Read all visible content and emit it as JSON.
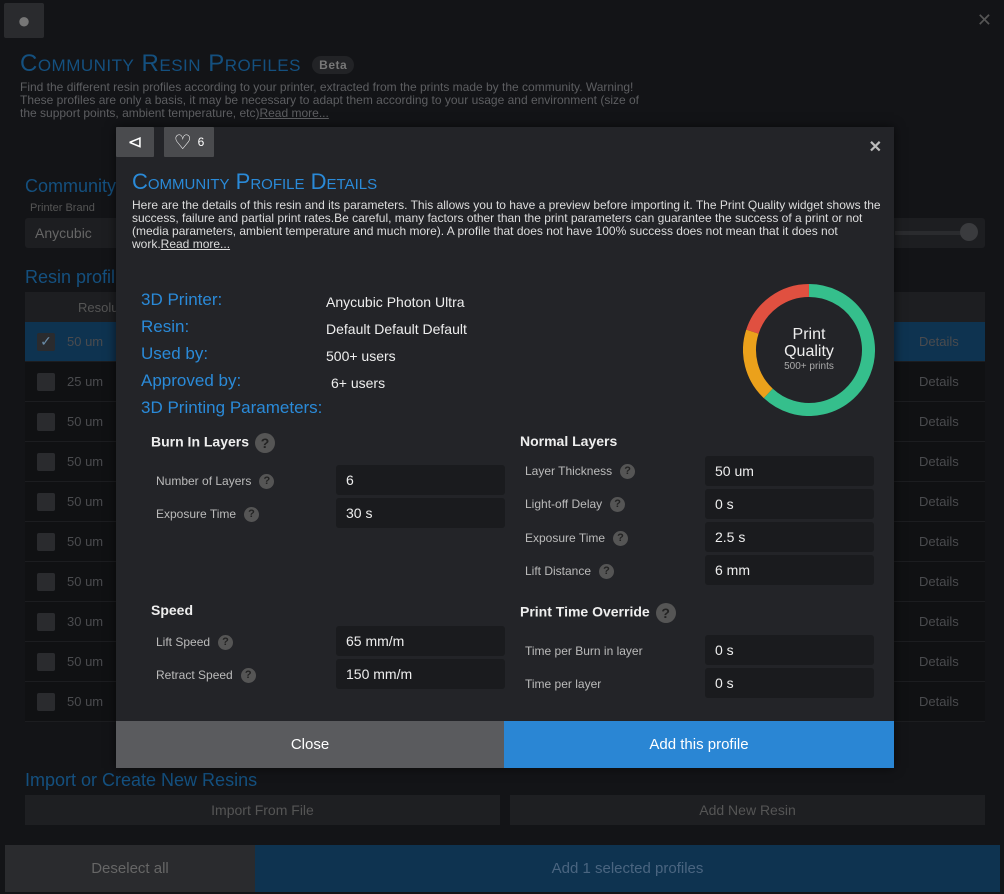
{
  "background": {
    "title": "Community Resin Profiles",
    "badge": "Beta",
    "description": "Find the different resin profiles according to your printer, extracted from the prints made by the community. Warning! These profiles are only a basis, it may be necessary to adapt them according to your usage and environment (size of the support points, ambient temperature, etc)",
    "read_more": "Read more...",
    "community_heading": "Community",
    "printer_brand_label": "Printer Brand",
    "printer_brand_value": "Anycubic",
    "resin_profiles_heading": "Resin profil",
    "table_header": "Resolu",
    "rows": [
      {
        "res": "50 um",
        "selected": true
      },
      {
        "res": "25 um"
      },
      {
        "res": "50 um"
      },
      {
        "res": "50 um"
      },
      {
        "res": "50 um"
      },
      {
        "res": "50 um"
      },
      {
        "res": "50 um"
      },
      {
        "res": "30 um"
      },
      {
        "res": "50 um"
      },
      {
        "res": "50 um"
      }
    ],
    "details_label": "Details",
    "import_heading": "Import or Create New Resins",
    "import_button": "Import From File",
    "add_new_button": "Add New Resin",
    "deselect_button": "Deselect all",
    "add_selected_button": "Add 1 selected profiles"
  },
  "modal": {
    "likes": "6",
    "title": "Community Profile Details",
    "description": "Here are the details of this resin and its parameters. This allows you to have a preview before importing it. The Print Quality widget shows the success, failure and partial print rates.Be careful, many factors other than the print parameters can guarantee the success of a print or not (media parameters, ambient temperature and much more). A profile that does not have 100% success does not mean that it does not work.",
    "read_more": "Read more...",
    "info": [
      {
        "label": "3D Printer:",
        "value": "Anycubic Photon Ultra"
      },
      {
        "label": "Resin:",
        "value": "Default Default Default"
      },
      {
        "label": "Used by:",
        "value": "500+ users"
      },
      {
        "label": "Approved by:",
        "value": "6+ users"
      },
      {
        "label": "3D Printing Parameters:"
      }
    ],
    "quality": {
      "title1": "Print",
      "title2": "Quality",
      "count": "500+ prints",
      "success": 0.62,
      "partial": 0.18,
      "failure": 0.2,
      "colors": {
        "success": "#35bf8c",
        "partial": "#eba11b",
        "failure": "#e05040"
      }
    },
    "burn_in": {
      "title": "Burn In Layers",
      "params": [
        {
          "label": "Number of Layers",
          "value": "6"
        },
        {
          "label": "Exposure Time",
          "value": "30 s"
        }
      ]
    },
    "normal": {
      "title": "Normal Layers",
      "params": [
        {
          "label": "Layer Thickness",
          "value": "50 um"
        },
        {
          "label": "Light-off Delay",
          "value": "0 s"
        },
        {
          "label": "Exposure Time",
          "value": "2.5 s"
        },
        {
          "label": "Lift Distance",
          "value": "6 mm"
        }
      ]
    },
    "speed": {
      "title": "Speed",
      "params": [
        {
          "label": "Lift Speed",
          "value": "65 mm/m"
        },
        {
          "label": "Retract Speed",
          "value": "150 mm/m"
        }
      ]
    },
    "override": {
      "title": "Print Time Override",
      "params": [
        {
          "label": "Time per Burn in layer",
          "value": "0 s"
        },
        {
          "label": "Time per layer",
          "value": "0 s"
        }
      ]
    },
    "close_button": "Close",
    "add_button": "Add this profile"
  }
}
